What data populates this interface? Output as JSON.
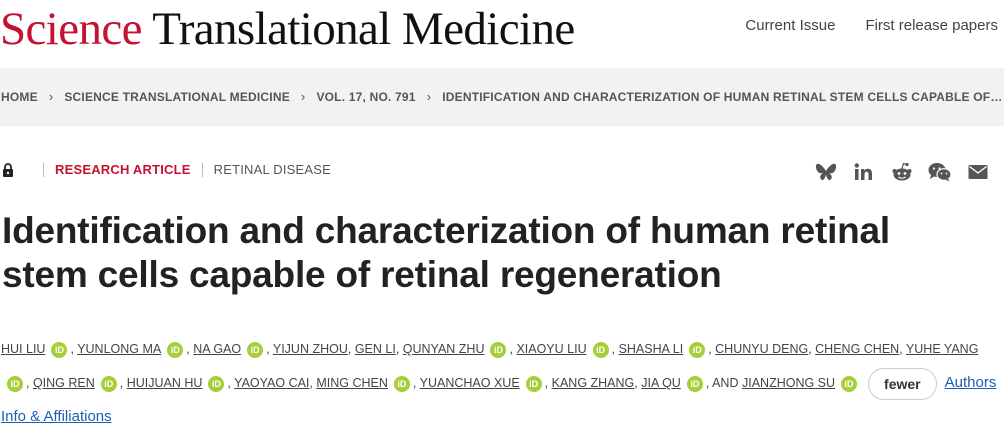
{
  "site": {
    "logo_science": "Science",
    "logo_rest": " Translational Medicine",
    "nav": [
      "Current Issue",
      "First release papers"
    ]
  },
  "breadcrumbs": [
    "HOME",
    "SCIENCE TRANSLATIONAL MEDICINE",
    "VOL. 17, NO. 791",
    "IDENTIFICATION AND CHARACTERIZATION OF HUMAN RETINAL STEM CELLS CAPABLE OF…"
  ],
  "article": {
    "type": "RESEARCH ARTICLE",
    "subject": "RETINAL DISEASE",
    "title": "Identification and characterization of human retinal stem cells capable of retinal regeneration"
  },
  "share_icons": [
    "bluesky-icon",
    "linkedin-icon",
    "reddit-icon",
    "wechat-icon",
    "email-icon"
  ],
  "authors": {
    "names": [
      "HUI LIU",
      "YUNLONG MA",
      "NA GAO",
      "YIJUN ZHOU",
      "GEN LI",
      "QUNYAN ZHU",
      "XIAOYU LIU",
      "SHASHA LI",
      "CHUNYU DENG",
      "CHENG CHEN",
      "YUHE YANG",
      "QING REN",
      "HUIJUAN HU",
      "YAOYAO CAI",
      "MING CHEN",
      "YUANCHAO XUE",
      "KANG ZHANG",
      "JIA QU",
      "JIANZHONG SU"
    ],
    "and": "AND",
    "orcid_label": "iD",
    "fewer_label": "fewer",
    "affiliations_label": "Authors Info & Affiliations"
  },
  "colors": {
    "brand_red": "#c41230",
    "orcid_green": "#a6ce39",
    "link_blue": "#1a5fb4"
  }
}
